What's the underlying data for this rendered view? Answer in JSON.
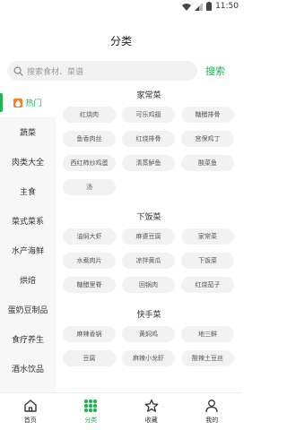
{
  "status_bar": {
    "time": "11:50",
    "icons": [
      "wifi-icon",
      "signal-icon",
      "battery-icon"
    ]
  },
  "header": {
    "title": "分类"
  },
  "search": {
    "placeholder": "搜索食材、菜谱",
    "button_label": "搜索"
  },
  "sidebar": {
    "items": [
      {
        "label": "热门",
        "active": true
      },
      {
        "label": "蔬菜"
      },
      {
        "label": "肉类大全"
      },
      {
        "label": "主食"
      },
      {
        "label": "菜式菜系"
      },
      {
        "label": "水产海鲜"
      },
      {
        "label": "烘焙"
      },
      {
        "label": "蛋奶豆制品"
      },
      {
        "label": "食疗养生"
      },
      {
        "label": "酒水饮品"
      }
    ]
  },
  "sections": [
    {
      "title": "家常菜",
      "tags": [
        "红烧肉",
        "可乐鸡翅",
        "糖醋排骨",
        "鱼香肉丝",
        "红烧排骨",
        "宫保鸡丁",
        "西红柿炒鸡蛋",
        "清蒸鲈鱼",
        "酸菜鱼",
        "汤"
      ]
    },
    {
      "title": "下饭菜",
      "tags": [
        "油焖大虾",
        "麻婆豆腐",
        "家常菜",
        "水煮肉片",
        "凉拌黄瓜",
        "下饭菜",
        "糖醋里脊",
        "回锅肉",
        "红烧茄子"
      ]
    },
    {
      "title": "快手菜",
      "tags": [
        "麻辣香锅",
        "黄焖鸡",
        "地三鲜",
        "豆腐",
        "麻辣小龙虾",
        "酸辣土豆丝"
      ]
    }
  ],
  "tab_bar": {
    "tabs": [
      {
        "label": "首页",
        "icon": "home-icon"
      },
      {
        "label": "分类",
        "icon": "grid-icon",
        "active": true
      },
      {
        "label": "收藏",
        "icon": "star-icon"
      },
      {
        "label": "我的",
        "icon": "user-icon"
      }
    ]
  },
  "colors": {
    "accent": "#1db652",
    "hot": "#ff7a1a"
  }
}
